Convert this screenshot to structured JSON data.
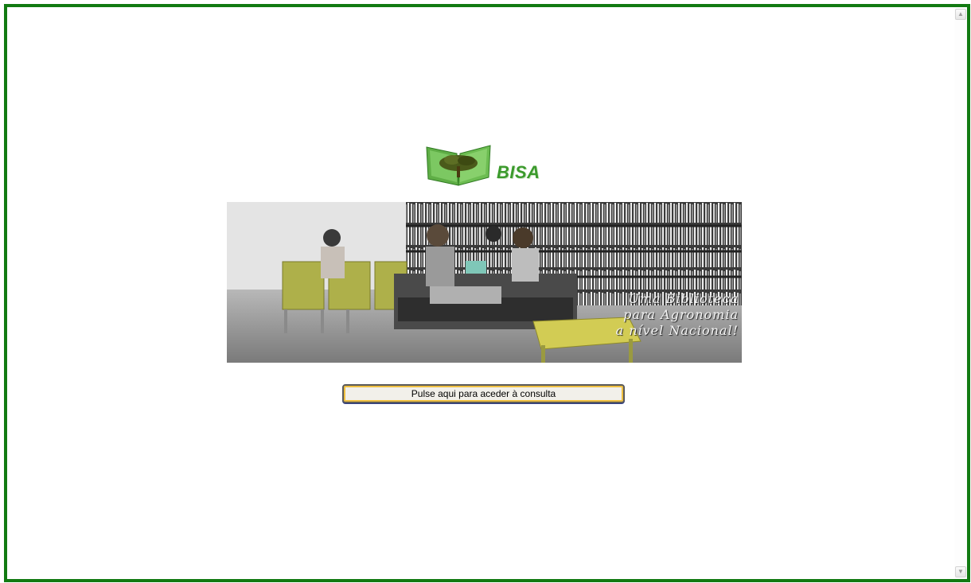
{
  "page": {
    "border_color": "#127a12",
    "background": "#ffffff"
  },
  "logo": {
    "text": "BISA",
    "icon": "tree-on-open-book-icon",
    "color": "#3b9a2c"
  },
  "banner": {
    "image": "library-reading-room-photo",
    "tagline": [
      "Uma Biblioteca",
      "para Agronomia",
      "a nível Nacional!"
    ]
  },
  "action": {
    "button_label": "Pulse aqui para aceder à consulta"
  },
  "scrollbar": {
    "up_icon": "scroll-up-arrow-icon",
    "down_icon": "scroll-down-arrow-icon"
  }
}
